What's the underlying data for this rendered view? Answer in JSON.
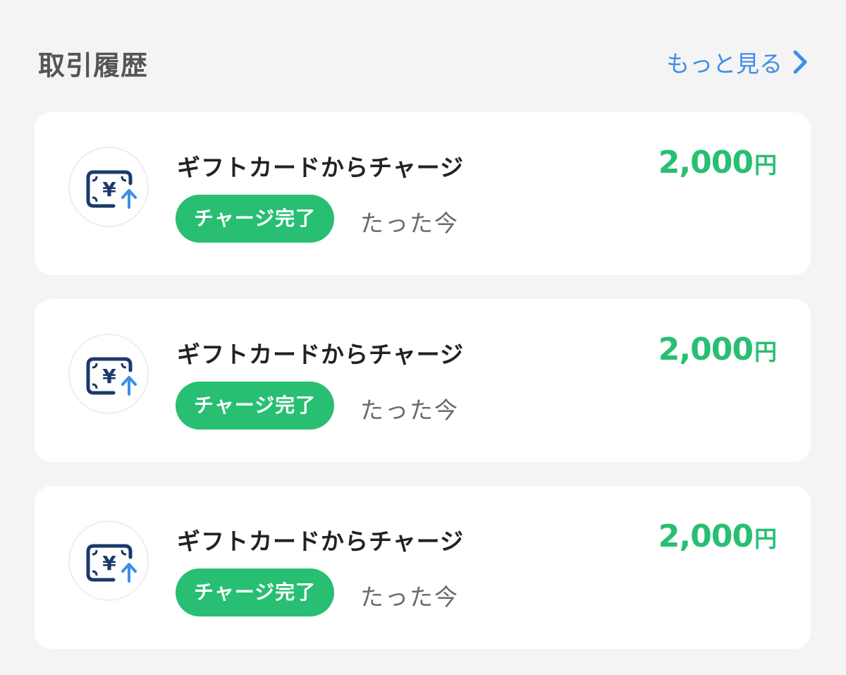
{
  "section": {
    "title": "取引履歴",
    "more_label": "もっと見る",
    "more_icon": "chevron-right-icon"
  },
  "colors": {
    "accent_green": "#28bf73",
    "link_blue": "#3d8fe6",
    "icon_navy": "#1b3a6b",
    "background": "#f4f4f5"
  },
  "transactions": [
    {
      "icon": "yen-charge-icon",
      "title": "ギフトカードからチャージ",
      "status": "チャージ完了",
      "time": "たった今",
      "amount": "2,000",
      "unit": "円"
    },
    {
      "icon": "yen-charge-icon",
      "title": "ギフトカードからチャージ",
      "status": "チャージ完了",
      "time": "たった今",
      "amount": "2,000",
      "unit": "円"
    },
    {
      "icon": "yen-charge-icon",
      "title": "ギフトカードからチャージ",
      "status": "チャージ完了",
      "time": "たった今",
      "amount": "2,000",
      "unit": "円"
    }
  ]
}
